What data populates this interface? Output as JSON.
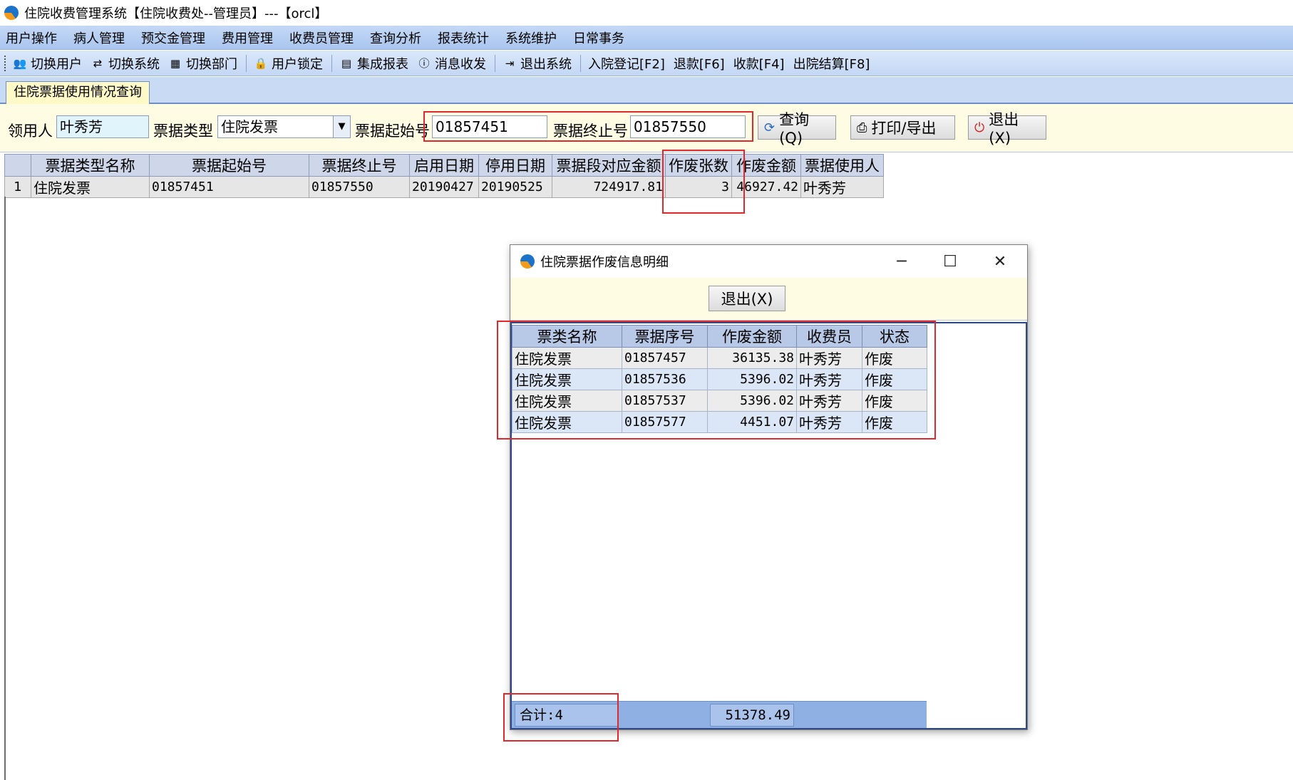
{
  "window": {
    "title": "住院收费管理系统【住院收费处--管理员】---【orcl】"
  },
  "menu": [
    "用户操作",
    "病人管理",
    "预交金管理",
    "费用管理",
    "收费员管理",
    "查询分析",
    "报表统计",
    "系统维护",
    "日常事务"
  ],
  "toolbar": {
    "switch_user": "切换用户",
    "switch_system": "切换系统",
    "switch_dept": "切换部门",
    "user_lock": "用户锁定",
    "integrated_report": "集成报表",
    "message": "消息收发",
    "exit_system": "退出系统",
    "admission": "入院登记[F2]",
    "refund": "退款[F6]",
    "collect": "收款[F4]",
    "discharge": "出院结算[F8]"
  },
  "tab": {
    "label": "住院票据使用情况查询"
  },
  "filter": {
    "recipient_label": "领用人",
    "recipient_value": "叶秀芳",
    "type_label": "票据类型",
    "type_value": "住院发票",
    "start_label": "票据起始号",
    "start_value": "01857451",
    "end_label": "票据终止号",
    "end_value": "01857550",
    "query_btn": "查询(Q)",
    "print_btn": "打印/导出",
    "exit_btn": "退出(X)"
  },
  "grid": {
    "headers": [
      "票据类型名称",
      "票据起始号",
      "票据终止号",
      "启用日期",
      "停用日期",
      "票据段对应金额",
      "作废张数",
      "作废金额",
      "票据使用人"
    ],
    "rows": [
      {
        "num": "1",
        "type": "住院发票",
        "start": "01857451",
        "end": "01857550",
        "enable_date": "20190427",
        "disable_date": "20190525",
        "amount": "724917.81",
        "void_count": "3",
        "void_amount": "46927.42",
        "user": "叶秀芳"
      }
    ]
  },
  "dialog": {
    "title": "住院票据作废信息明细",
    "exit_btn": "退出(X)",
    "headers": [
      "票类名称",
      "票据序号",
      "作废金额",
      "收费员",
      "状态"
    ],
    "rows": [
      {
        "name": "住院发票",
        "serial": "01857457",
        "amount": "36135.38",
        "cashier": "叶秀芳",
        "status": "作废"
      },
      {
        "name": "住院发票",
        "serial": "01857536",
        "amount": "5396.02",
        "cashier": "叶秀芳",
        "status": "作废"
      },
      {
        "name": "住院发票",
        "serial": "01857537",
        "amount": "5396.02",
        "cashier": "叶秀芳",
        "status": "作废"
      },
      {
        "name": "住院发票",
        "serial": "01857577",
        "amount": "4451.07",
        "cashier": "叶秀芳",
        "status": "作废"
      }
    ],
    "footer_count": "合计:4",
    "footer_total": "51378.49"
  },
  "icons": {
    "app_logo": "app-logo-icon",
    "minimize": "─",
    "maximize": "☐",
    "close": "✕"
  },
  "colors": {
    "annotation_red": "#e0282f",
    "menu_blue": "#a9c5ee",
    "filter_yellow": "#fefde4"
  }
}
